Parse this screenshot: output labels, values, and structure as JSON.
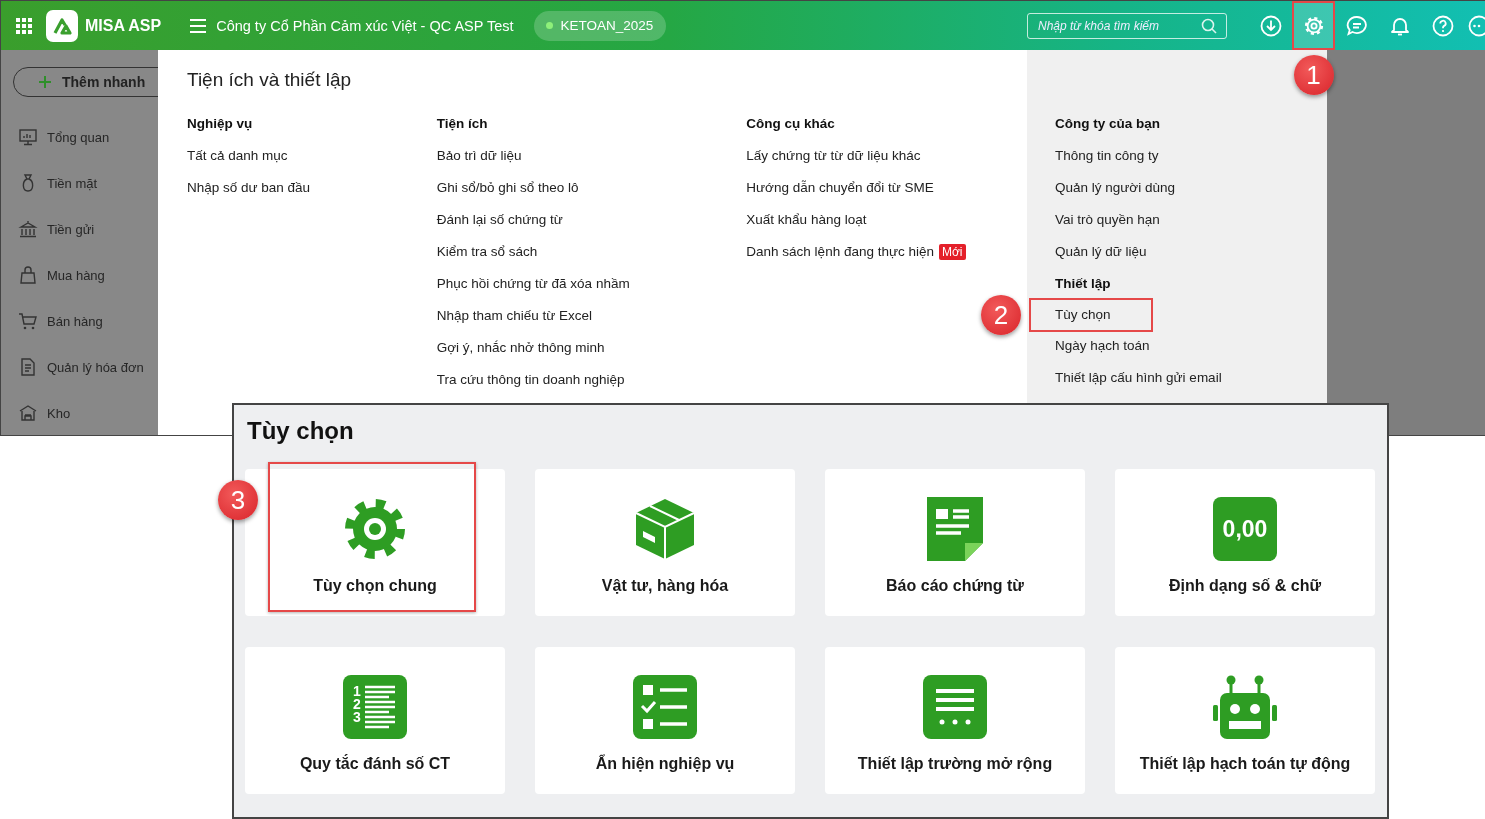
{
  "top_bar": {
    "app_name": "MISA ASP",
    "company": "Công ty Cổ Phần Cảm xúc Việt - QC ASP Test",
    "database": "KETOAN_2025",
    "search": {
      "placeholder": "Nhập từ khóa tìm kiếm"
    },
    "tools": [
      {
        "kind": "download",
        "highlighted": false
      },
      {
        "kind": "settings",
        "highlighted": true,
        "callout": "1"
      },
      {
        "kind": "chat",
        "highlighted": false
      },
      {
        "kind": "bell",
        "highlighted": false
      },
      {
        "kind": "help",
        "highlighted": false
      },
      {
        "kind": "more",
        "highlighted": false
      }
    ]
  },
  "sidebar": {
    "quick_add": "Thêm nhanh",
    "items": [
      {
        "kind": "monitor",
        "label": "Tổng quan"
      },
      {
        "kind": "money-bag",
        "label": "Tiền mặt"
      },
      {
        "kind": "bank",
        "label": "Tiền gửi"
      },
      {
        "kind": "bag",
        "label": "Mua hàng"
      },
      {
        "kind": "cart",
        "label": "Bán hàng"
      },
      {
        "kind": "document",
        "label": "Quản lý hóa đơn"
      },
      {
        "kind": "warehouse",
        "label": "Kho"
      }
    ]
  },
  "menu": {
    "title": "Tiện ích và thiết lập",
    "columns": [
      {
        "shaded": false,
        "sections": [
          {
            "heading": "Nghiệp vụ",
            "items": [
              {
                "label": "Tất cả danh mục",
                "highlighted": false
              },
              {
                "label": "Nhập số dư ban đầu",
                "highlighted": false
              }
            ]
          }
        ]
      },
      {
        "shaded": false,
        "sections": [
          {
            "heading": "Tiện ích",
            "items": [
              {
                "label": "Bảo trì dữ liệu",
                "highlighted": false
              },
              {
                "label": "Ghi sổ/bỏ ghi sổ theo lô",
                "highlighted": false
              },
              {
                "label": "Đánh lại số chứng từ",
                "highlighted": false
              },
              {
                "label": "Kiểm tra sổ sách",
                "highlighted": false
              },
              {
                "label": "Phục hồi chứng từ đã xóa nhầm",
                "highlighted": false
              },
              {
                "label": "Nhập tham chiếu từ Excel",
                "highlighted": false
              },
              {
                "label": "Gợi ý, nhắc nhở thông minh",
                "highlighted": false
              },
              {
                "label": "Tra cứu thông tin doanh nghiệp",
                "highlighted": false
              }
            ]
          }
        ]
      },
      {
        "shaded": false,
        "sections": [
          {
            "heading": "Công cụ khác",
            "items": [
              {
                "label": "Lấy chứng từ từ dữ liệu khác",
                "highlighted": false
              },
              {
                "label": "Hướng dẫn chuyển đổi từ SME",
                "highlighted": false
              },
              {
                "label": "Xuất khẩu hàng loạt",
                "highlighted": false
              },
              {
                "label": "Danh sách lệnh đang thực hiện",
                "badge": "Mới",
                "highlighted": false
              }
            ]
          }
        ]
      },
      {
        "shaded": true,
        "sections": [
          {
            "heading": "Công ty của bạn",
            "items": [
              {
                "label": "Thông tin công ty",
                "highlighted": false
              },
              {
                "label": "Quản lý người dùng",
                "highlighted": false
              },
              {
                "label": "Vai trò quyền hạn",
                "highlighted": false
              },
              {
                "label": "Quản lý dữ liệu",
                "highlighted": false
              }
            ]
          },
          {
            "heading": "Thiết lập",
            "items": [
              {
                "label": "Tùy chọn",
                "highlighted": true,
                "callout": "2"
              },
              {
                "label": "Ngày hạch toán",
                "highlighted": false
              },
              {
                "label": "Thiết lập cấu hình gửi email",
                "highlighted": false
              }
            ]
          }
        ]
      }
    ]
  },
  "options": {
    "title": "Tùy chọn",
    "cards": [
      {
        "kind": "gear",
        "label": "Tùy chọn chung",
        "highlighted": true,
        "callout": "3"
      },
      {
        "kind": "box",
        "label": "Vật tư, hàng hóa",
        "highlighted": false
      },
      {
        "kind": "report",
        "label": "Báo cáo chứng từ",
        "highlighted": false
      },
      {
        "kind": "number",
        "icon_text": "0,00",
        "label": "Định dạng số & chữ",
        "highlighted": false
      },
      {
        "kind": "numbered-list",
        "icon_text": [
          "1",
          "2",
          "3"
        ],
        "label": "Quy tắc đánh số CT",
        "highlighted": false
      },
      {
        "kind": "checklist",
        "label": "Ẩn hiện nghiệp vụ",
        "highlighted": false
      },
      {
        "kind": "form",
        "label": "Thiết lập trường mở rộng",
        "highlighted": false
      },
      {
        "kind": "robot",
        "label": "Thiết lập hạch toán tự động",
        "highlighted": false
      }
    ]
  }
}
